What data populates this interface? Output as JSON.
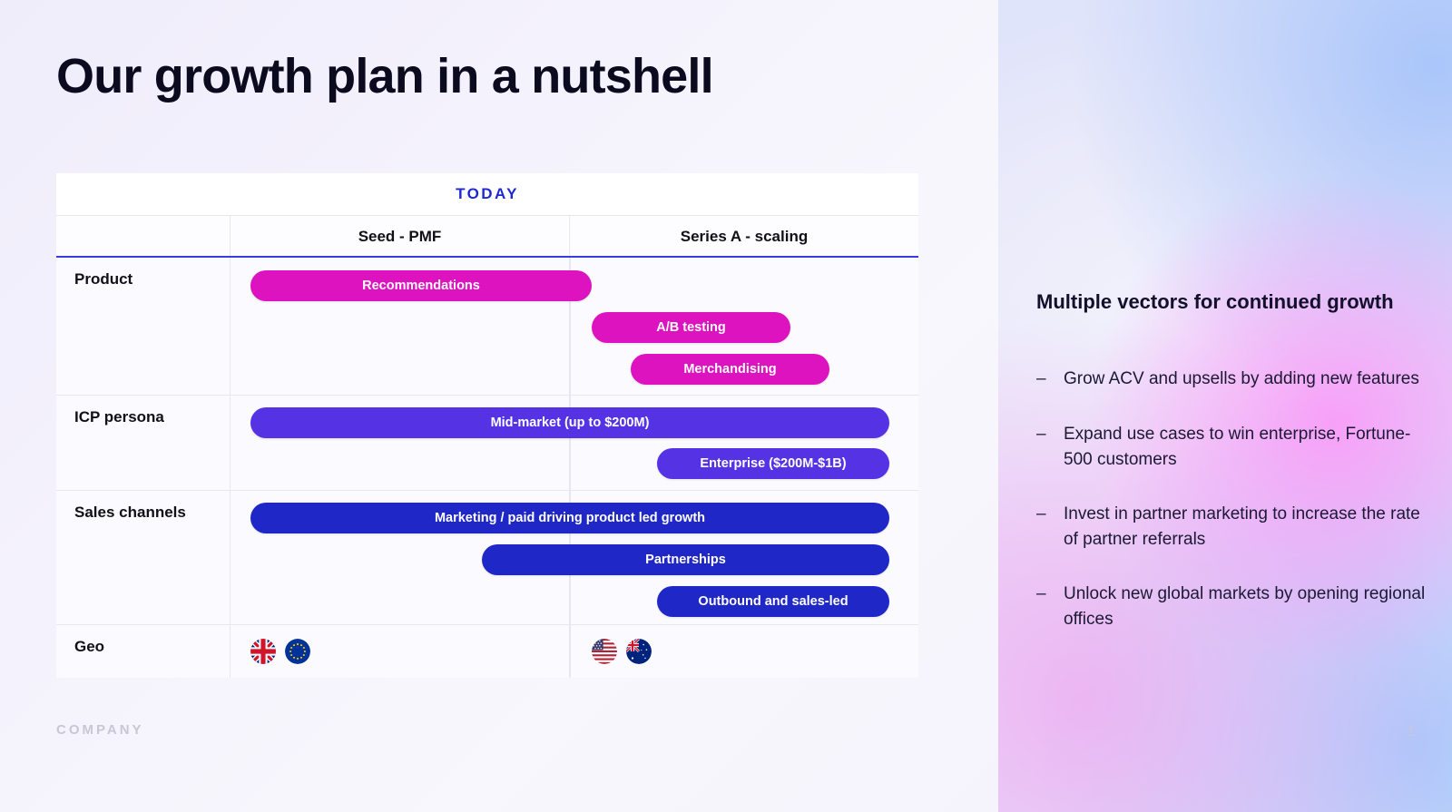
{
  "slide": {
    "title": "Our growth plan in a nutshell",
    "footer_company": "COMPANY",
    "page_number": "1"
  },
  "table": {
    "today_label": "TODAY",
    "columns": [
      {
        "key": "label",
        "header": ""
      },
      {
        "key": "seed",
        "header": "Seed - PMF"
      },
      {
        "key": "series_a",
        "header": "Series A - scaling"
      }
    ],
    "rows": [
      {
        "label": "Product",
        "color": "#dd13c0",
        "pills": [
          {
            "text": "Recommendations",
            "color": "magenta"
          },
          {
            "text": "A/B testing",
            "color": "magenta"
          },
          {
            "text": "Merchandising",
            "color": "magenta"
          }
        ]
      },
      {
        "label": "ICP persona",
        "color": "#5533e5",
        "pills": [
          {
            "text": "Mid-market (up to $200M)",
            "color": "purple"
          },
          {
            "text": "Enterprise ($200M-$1B)",
            "color": "purple"
          }
        ]
      },
      {
        "label": "Sales channels",
        "color": "#1f28c6",
        "pills": [
          {
            "text": "Marketing / paid driving product led growth",
            "color": "blue"
          },
          {
            "text": "Partnerships",
            "color": "blue"
          },
          {
            "text": "Outbound and sales-led",
            "color": "blue"
          }
        ]
      },
      {
        "label": "Geo",
        "flags_seed": [
          "uk-flag",
          "eu-flag"
        ],
        "flags_series_a": [
          "us-flag",
          "au-flag"
        ]
      }
    ]
  },
  "right_panel": {
    "heading": "Multiple vectors for continued growth",
    "bullet_marker": "–",
    "bullets": [
      "Grow ACV and upsells by adding new features",
      "Expand use cases to win enterprise, Fortune-500 customers",
      "Invest in partner marketing to increase the rate of partner referrals",
      "Unlock new global markets by opening regional offices"
    ]
  },
  "colors": {
    "magenta": "#dd13c0",
    "purple": "#5533e5",
    "blue": "#1f28c6",
    "today_blue": "#1e28d2",
    "title_dark": "#0c0a1e"
  }
}
